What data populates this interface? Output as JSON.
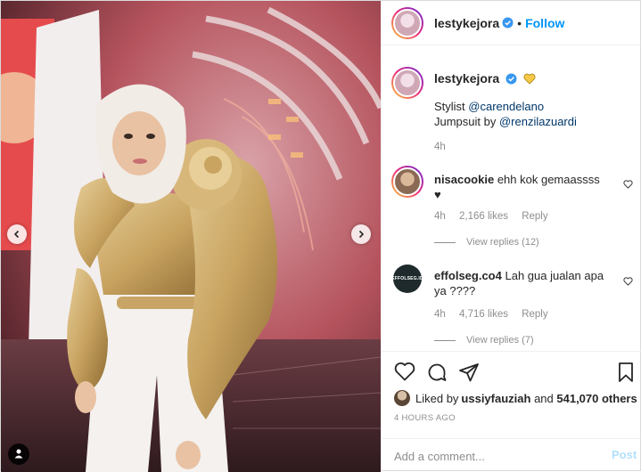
{
  "header": {
    "username": "lestykejora",
    "separator": "•",
    "follow_label": "Follow"
  },
  "caption": {
    "username": "lestykejora",
    "line1_prefix": "Stylist ",
    "line1_mention": "@carendelano",
    "line2_prefix": "Jumpsuit by ",
    "line2_mention": "@renzilazuardi",
    "time": "4h"
  },
  "comments": [
    {
      "username": "nisacookie",
      "text": "ehh kok gemaassss",
      "text2": "♥",
      "time": "4h",
      "likes": "2,166 likes",
      "reply_label": "Reply",
      "view_replies": "View replies (12)"
    },
    {
      "username": "effolseg.co4",
      "avatar_text": "EFFOLSEG.ID",
      "text": "Lah gua jualan apa ya ????",
      "time": "4h",
      "likes": "4,716 likes",
      "reply_label": "Reply",
      "view_replies": "View replies (7)"
    }
  ],
  "likes": {
    "prefix": "Liked by ",
    "user": "ussiyfauziah",
    "middle": " and ",
    "count": "541,070 others"
  },
  "timestamp": "4 HOURS AGO",
  "add_comment": {
    "placeholder": "Add a comment...",
    "post_label": "Post"
  },
  "colors": {
    "accent": "#0095f6",
    "muted": "#8e8e8e",
    "verified": "#3897f0",
    "heart_emoji": "#f7c948"
  },
  "icons": [
    "verified-icon",
    "yellow-heart-icon",
    "heart-icon",
    "comment-icon",
    "share-icon",
    "bookmark-icon",
    "chevron-left-icon",
    "chevron-right-icon",
    "user-tag-icon"
  ]
}
